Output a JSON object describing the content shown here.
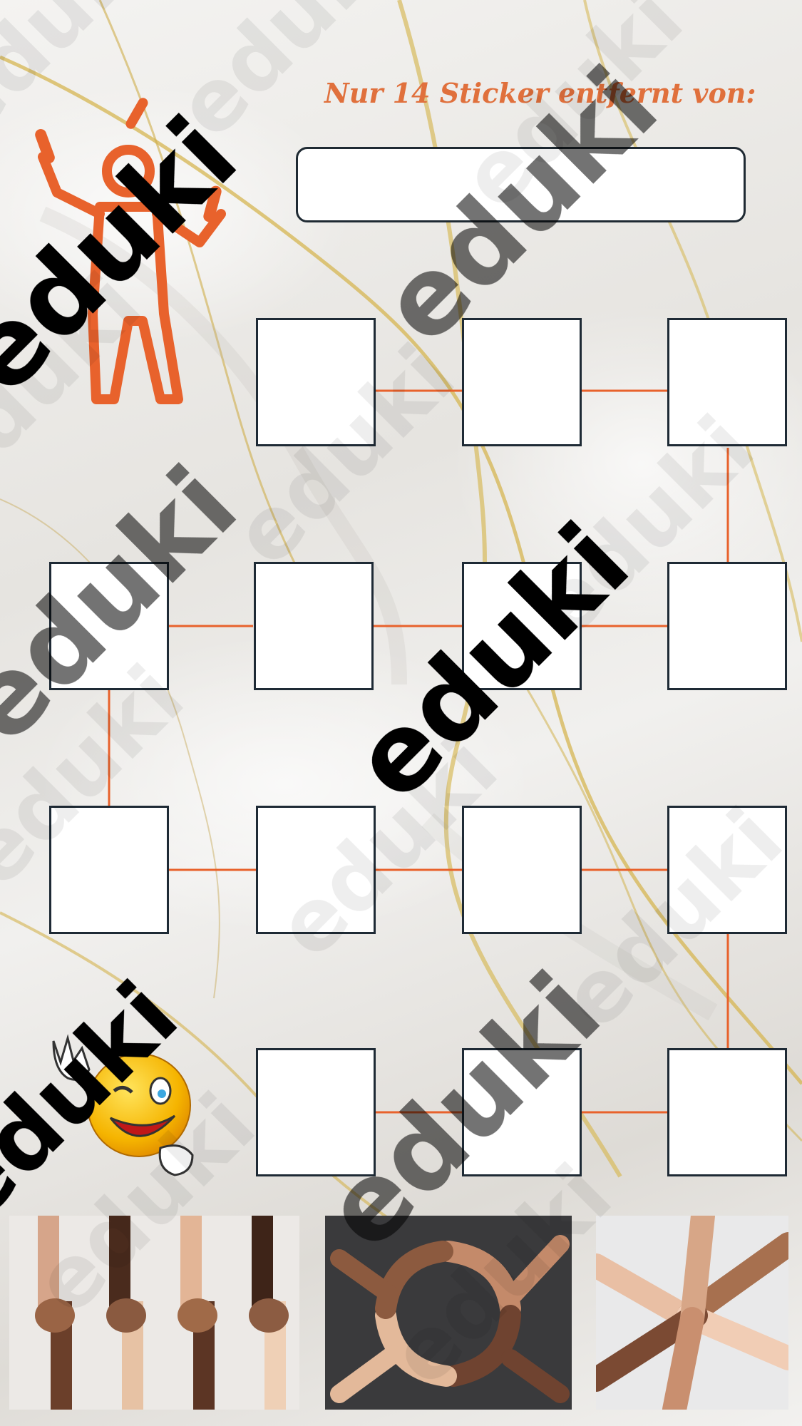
{
  "header": {
    "title": "Nur 14 Sticker entfernt von:",
    "name_field": ""
  },
  "board": {
    "slot_count": 14,
    "slot_fill": "#ffffff",
    "slot_border": "#1e2a35",
    "connector_color": "#e8622c"
  },
  "watermark": {
    "text": "eduki"
  },
  "decorations": {
    "mascot": "juggler-icon",
    "smiley": "winking-smiley-icon"
  },
  "photos": [
    {
      "name": "handshakes-photo"
    },
    {
      "name": "hands-circle-photo"
    },
    {
      "name": "hands-star-photo"
    }
  ],
  "colors": {
    "accent": "#e0703c",
    "gold": "#d4b04a",
    "dark": "#1e2a35"
  }
}
